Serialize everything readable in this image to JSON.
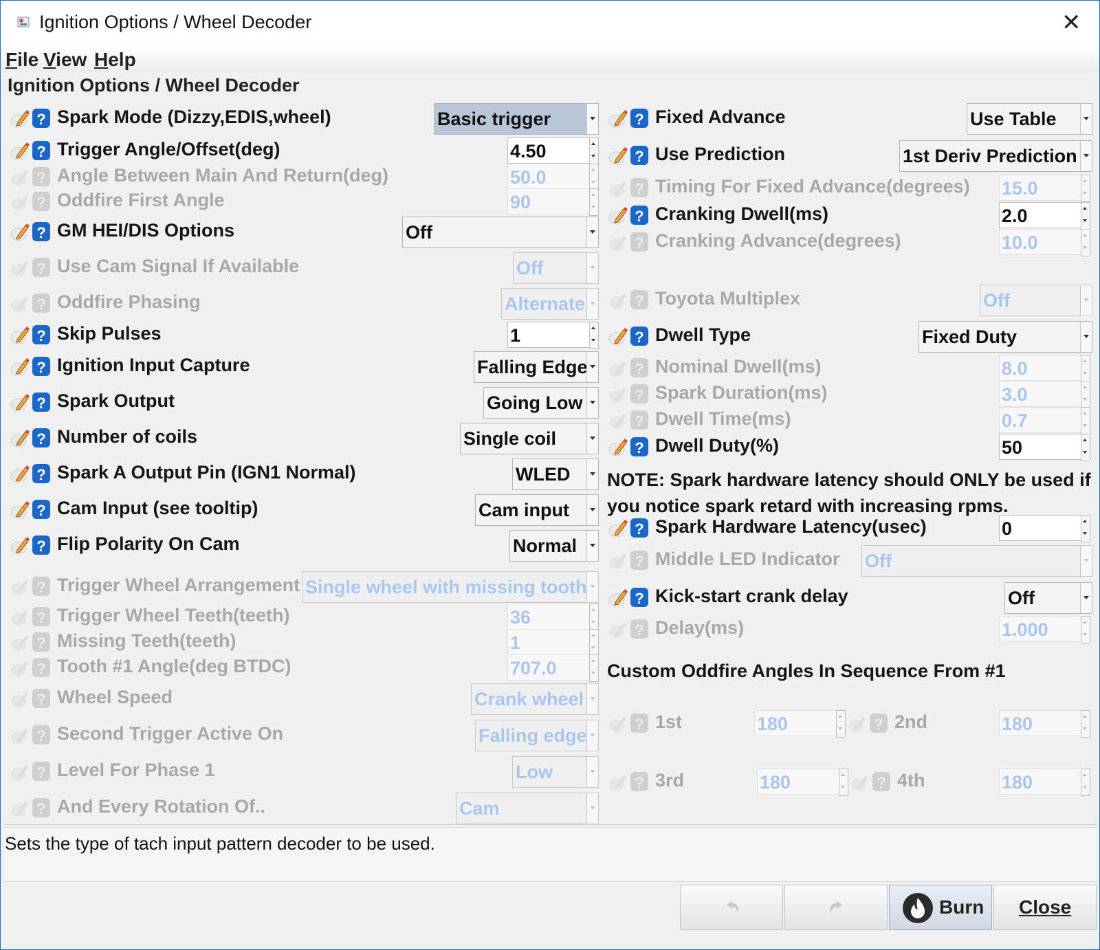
{
  "window": {
    "title": "Ignition Options / Wheel Decoder",
    "close_symbol": "✕"
  },
  "menu": [
    "File",
    "View",
    "Help"
  ],
  "panel_title": "Ignition Options / Wheel Decoder",
  "left": [
    {
      "label": "Spark Mode (Dizzy,EDIS,wheel)",
      "type": "combo",
      "value": "Basic trigger",
      "enabled": true,
      "highlight": true
    },
    {
      "label": "Trigger Angle/Offset(deg)",
      "type": "spin",
      "value": "4.50",
      "enabled": true
    },
    {
      "label": "Angle Between Main And Return(deg)",
      "type": "spin",
      "value": "50.0",
      "enabled": false
    },
    {
      "label": "Oddfire First Angle",
      "type": "spin",
      "value": "90",
      "enabled": false
    },
    {
      "label": "GM HEI/DIS Options",
      "type": "combo",
      "value": "Off",
      "enabled": true
    },
    {
      "label": "Use Cam Signal If Available",
      "type": "combo",
      "value": "Off",
      "enabled": false
    },
    {
      "label": "Oddfire Phasing",
      "type": "combo",
      "value": "Alternate",
      "enabled": false
    },
    {
      "label": "Skip Pulses",
      "type": "spin",
      "value": "1",
      "enabled": true
    },
    {
      "label": "Ignition Input Capture",
      "type": "combo",
      "value": "Falling Edge",
      "enabled": true
    },
    {
      "label": "Spark Output",
      "type": "combo",
      "value": "Going Low",
      "enabled": true
    },
    {
      "label": "Number of coils",
      "type": "combo",
      "value": "Single coil",
      "enabled": true
    },
    {
      "label": "Spark A Output Pin (IGN1 Normal)",
      "type": "combo",
      "value": "WLED",
      "enabled": true
    },
    {
      "label": "Cam Input (see tooltip)",
      "type": "combo",
      "value": "Cam input",
      "enabled": true
    },
    {
      "label": "Flip Polarity On Cam",
      "type": "combo",
      "value": "Normal",
      "enabled": true
    },
    {
      "label": "Trigger Wheel Arrangement",
      "type": "combo",
      "value": "Single wheel with missing tooth",
      "enabled": false
    },
    {
      "label": "Trigger Wheel Teeth(teeth)",
      "type": "spin",
      "value": "36",
      "enabled": false
    },
    {
      "label": "Missing Teeth(teeth)",
      "type": "spin",
      "value": "1",
      "enabled": false
    },
    {
      "label": "Tooth #1 Angle(deg BTDC)",
      "type": "spin",
      "value": "707.0",
      "enabled": false
    },
    {
      "label": "Wheel Speed",
      "type": "combo",
      "value": "Crank wheel",
      "enabled": false
    },
    {
      "label": "Second Trigger Active On",
      "type": "combo",
      "value": "Falling edge",
      "enabled": false
    },
    {
      "label": "Level For Phase 1",
      "type": "combo",
      "value": "Low",
      "enabled": false
    },
    {
      "label": "And Every Rotation Of..",
      "type": "combo",
      "value": "Cam",
      "enabled": false
    }
  ],
  "right": [
    {
      "label": "Fixed Advance",
      "type": "combo",
      "value": "Use Table",
      "enabled": true
    },
    {
      "label": "Use Prediction",
      "type": "combo",
      "value": "1st Deriv Prediction",
      "enabled": true
    },
    {
      "label": "Timing For Fixed Advance(degrees)",
      "type": "spin",
      "value": "15.0",
      "enabled": false
    },
    {
      "label": "Cranking Dwell(ms)",
      "type": "spin",
      "value": "2.0",
      "enabled": true
    },
    {
      "label": "Cranking Advance(degrees)",
      "type": "spin",
      "value": "10.0",
      "enabled": false
    },
    {
      "label": "Toyota Multiplex",
      "type": "combo",
      "value": "Off",
      "enabled": false
    },
    {
      "label": "Dwell Type",
      "type": "combo",
      "value": "Fixed Duty",
      "enabled": true
    },
    {
      "label": "Nominal Dwell(ms)",
      "type": "spin",
      "value": "8.0",
      "enabled": false
    },
    {
      "label": "Spark Duration(ms)",
      "type": "spin",
      "value": "3.0",
      "enabled": false
    },
    {
      "label": "Dwell Time(ms)",
      "type": "spin",
      "value": "0.7",
      "enabled": false
    },
    {
      "label": "Dwell Duty(%)",
      "type": "spin",
      "value": "50",
      "enabled": true
    },
    {
      "label": "Spark Hardware Latency(usec)",
      "type": "spin",
      "value": "0",
      "enabled": true
    },
    {
      "label": "Middle LED Indicator",
      "type": "combo",
      "value": "Off",
      "enabled": false
    },
    {
      "label": "Kick-start crank delay",
      "type": "combo",
      "value": "Off",
      "enabled": true
    },
    {
      "label": "Delay(ms)",
      "type": "spin",
      "value": "1.000",
      "enabled": false
    }
  ],
  "note_line1": "NOTE: Spark hardware latency should ONLY be used if",
  "note_line2": "you notice spark retard with increasing rpms.",
  "oddfire_heading": "Custom Oddfire Angles In Sequence From #1",
  "oddfire": [
    {
      "label": "1st",
      "value": "180"
    },
    {
      "label": "2nd",
      "value": "180"
    },
    {
      "label": "3rd",
      "value": "180"
    },
    {
      "label": "4th",
      "value": "180"
    }
  ],
  "status_text": "Sets the type of tach input pattern decoder to be used.",
  "buttons": {
    "undo_icon": "undo-icon",
    "redo_icon": "redo-icon",
    "burn": "Burn",
    "close": "Close"
  },
  "colors": {
    "disabled_value": "#a9c7ee",
    "help_icon": "#1a66c9",
    "accent": "#1e6fbf"
  }
}
